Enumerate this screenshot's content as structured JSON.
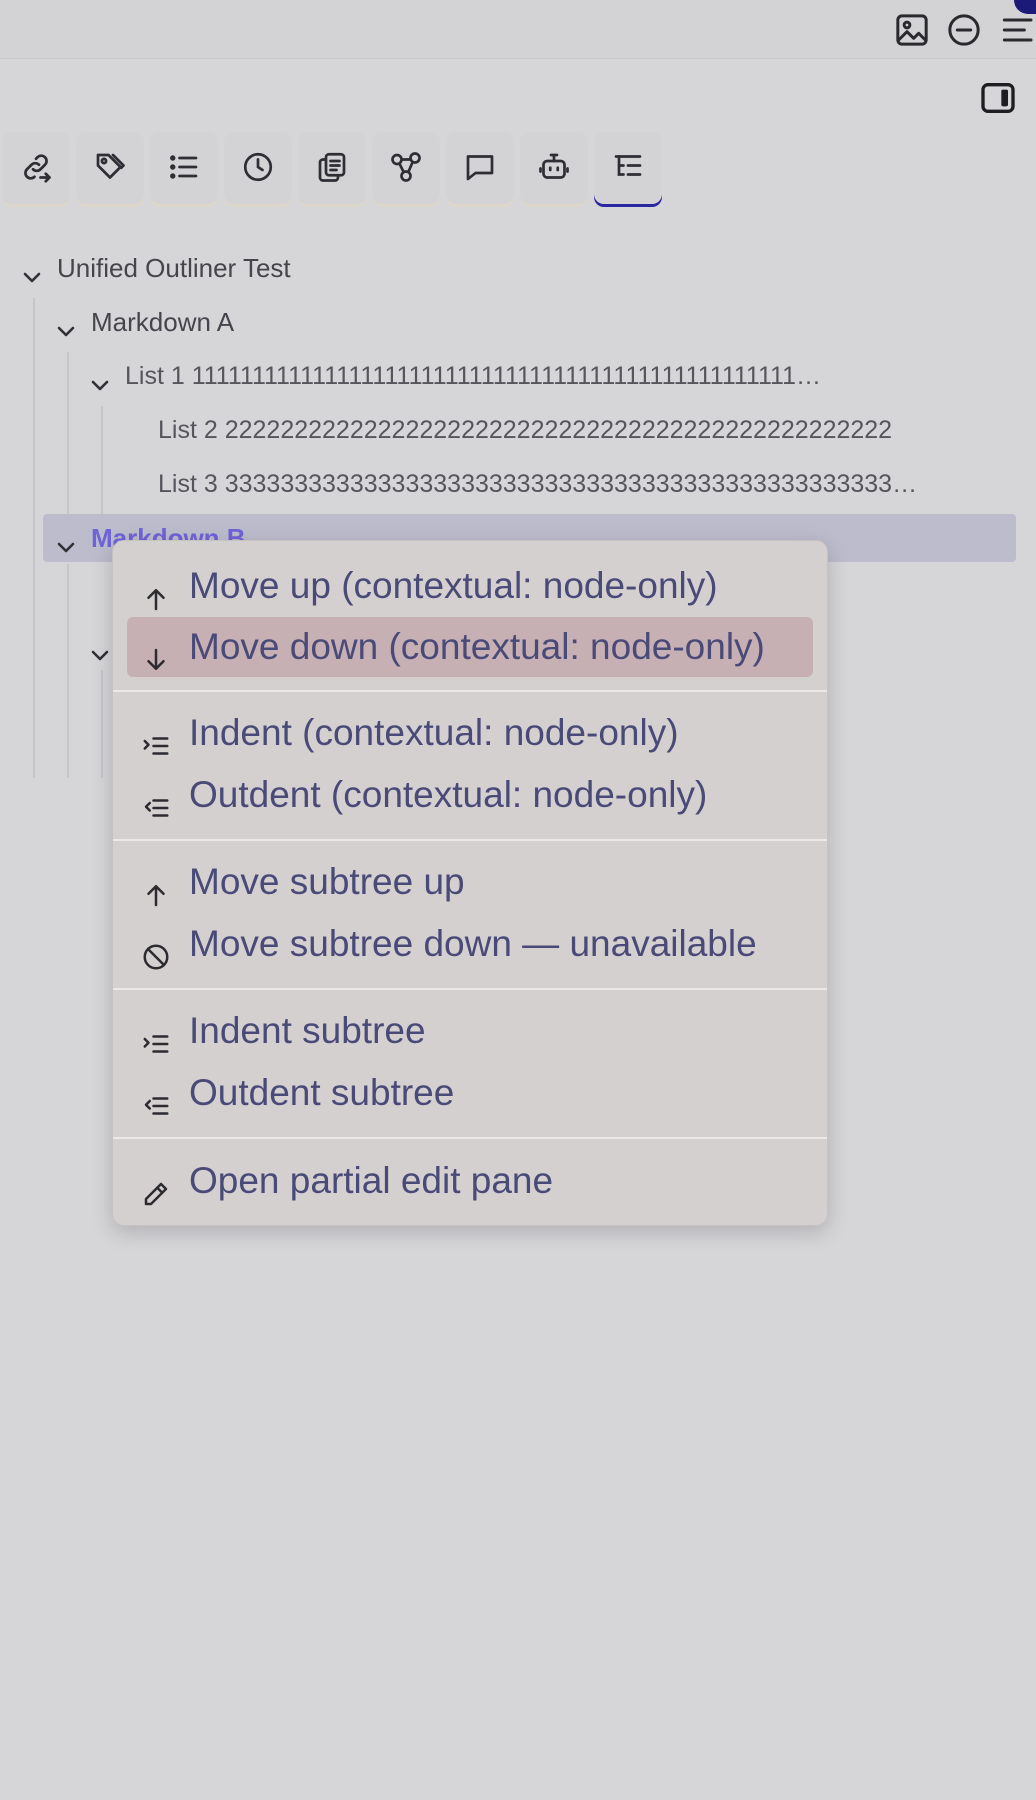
{
  "topbar": {
    "icons": [
      "image-icon",
      "minus-circle-icon",
      "menu-icon"
    ]
  },
  "sidebar_toggle_icon": "sidebar-toggle-icon",
  "tabs": [
    {
      "icon": "link-arrow-icon"
    },
    {
      "icon": "tags-icon"
    },
    {
      "icon": "list-icon"
    },
    {
      "icon": "clock-icon"
    },
    {
      "icon": "copy-icon"
    },
    {
      "icon": "graph-icon"
    },
    {
      "icon": "comment-icon"
    },
    {
      "icon": "robot-icon"
    },
    {
      "icon": "outline-icon",
      "active": true
    }
  ],
  "tree": {
    "root": "Unified Outliner Test",
    "markdown_a": "Markdown A",
    "list1": "List 1 11111111111111111111111111111111111111111111111111…",
    "list2": "List 2 222222222222222222222222222222222222222222222222",
    "list3": "List 3 333333333333333333333333333333333333333333333333…",
    "markdown_b": "Markdown B"
  },
  "menu": {
    "move_up": "Move up (contextual: node-only)",
    "move_down": "Move down (contextual: node-only)",
    "indent": "Indent (contextual: node-only)",
    "outdent": "Outdent (contextual: node-only)",
    "move_subtree_up": "Move subtree up",
    "move_subtree_down": "Move subtree down — unavailable",
    "indent_subtree": "Indent subtree",
    "outdent_subtree": "Outdent subtree",
    "open_partial_edit": "Open partial edit pane"
  },
  "colors": {
    "background": "#d6d6d9",
    "menu_bg": "#d5d0d0",
    "menu_text": "#4a4a78",
    "highlight": "#c7b0b4",
    "selected_row": "#bdbccc",
    "selected_text": "#6f63d8",
    "active_tab_accent": "#2a27a0"
  }
}
